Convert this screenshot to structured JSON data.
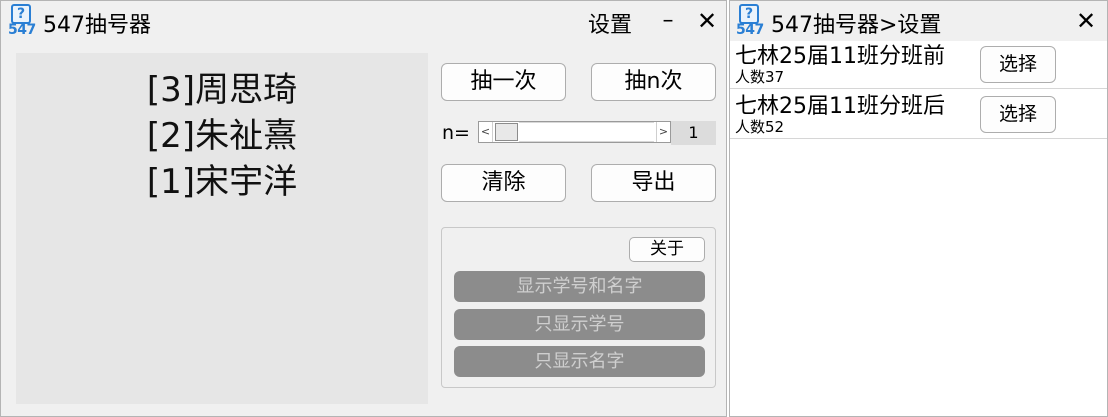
{
  "main_window": {
    "icon_glyph": "?",
    "icon_number": "547",
    "title": "547抽号器",
    "settings_link": "设置",
    "minimize_glyph": "–",
    "close_glyph": "✕",
    "results": [
      "[3]周思琦",
      "[2]朱祉熹",
      "[1]宋宇洋"
    ],
    "buttons": {
      "draw_once": "抽一次",
      "draw_n": "抽n次",
      "clear": "清除",
      "export": "导出"
    },
    "n_label": "n=",
    "n_slider": {
      "left_arrow": "<",
      "right_arrow": ">",
      "value": "1",
      "min": 1
    },
    "options": {
      "about": "关于",
      "show_id_and_name": "显示学号和名字",
      "show_id_only": "只显示学号",
      "show_name_only": "只显示名字"
    }
  },
  "settings_window": {
    "icon_glyph": "?",
    "icon_number": "547",
    "title": "547抽号器>设置",
    "close_glyph": "✕",
    "classes": [
      {
        "name": "七林25届11班分班前",
        "count": "人数37",
        "select_label": "选择"
      },
      {
        "name": "七林25届11班分班后",
        "count": "人数52",
        "select_label": "选择"
      }
    ]
  },
  "colors": {
    "accent": "#2a7fd4",
    "window_bg": "#f0f0f0",
    "result_bg": "#e6e6e6",
    "disabled_button": "#8c8c8c"
  },
  "icons": [
    "app-icon",
    "minimize-icon",
    "close-icon"
  ]
}
